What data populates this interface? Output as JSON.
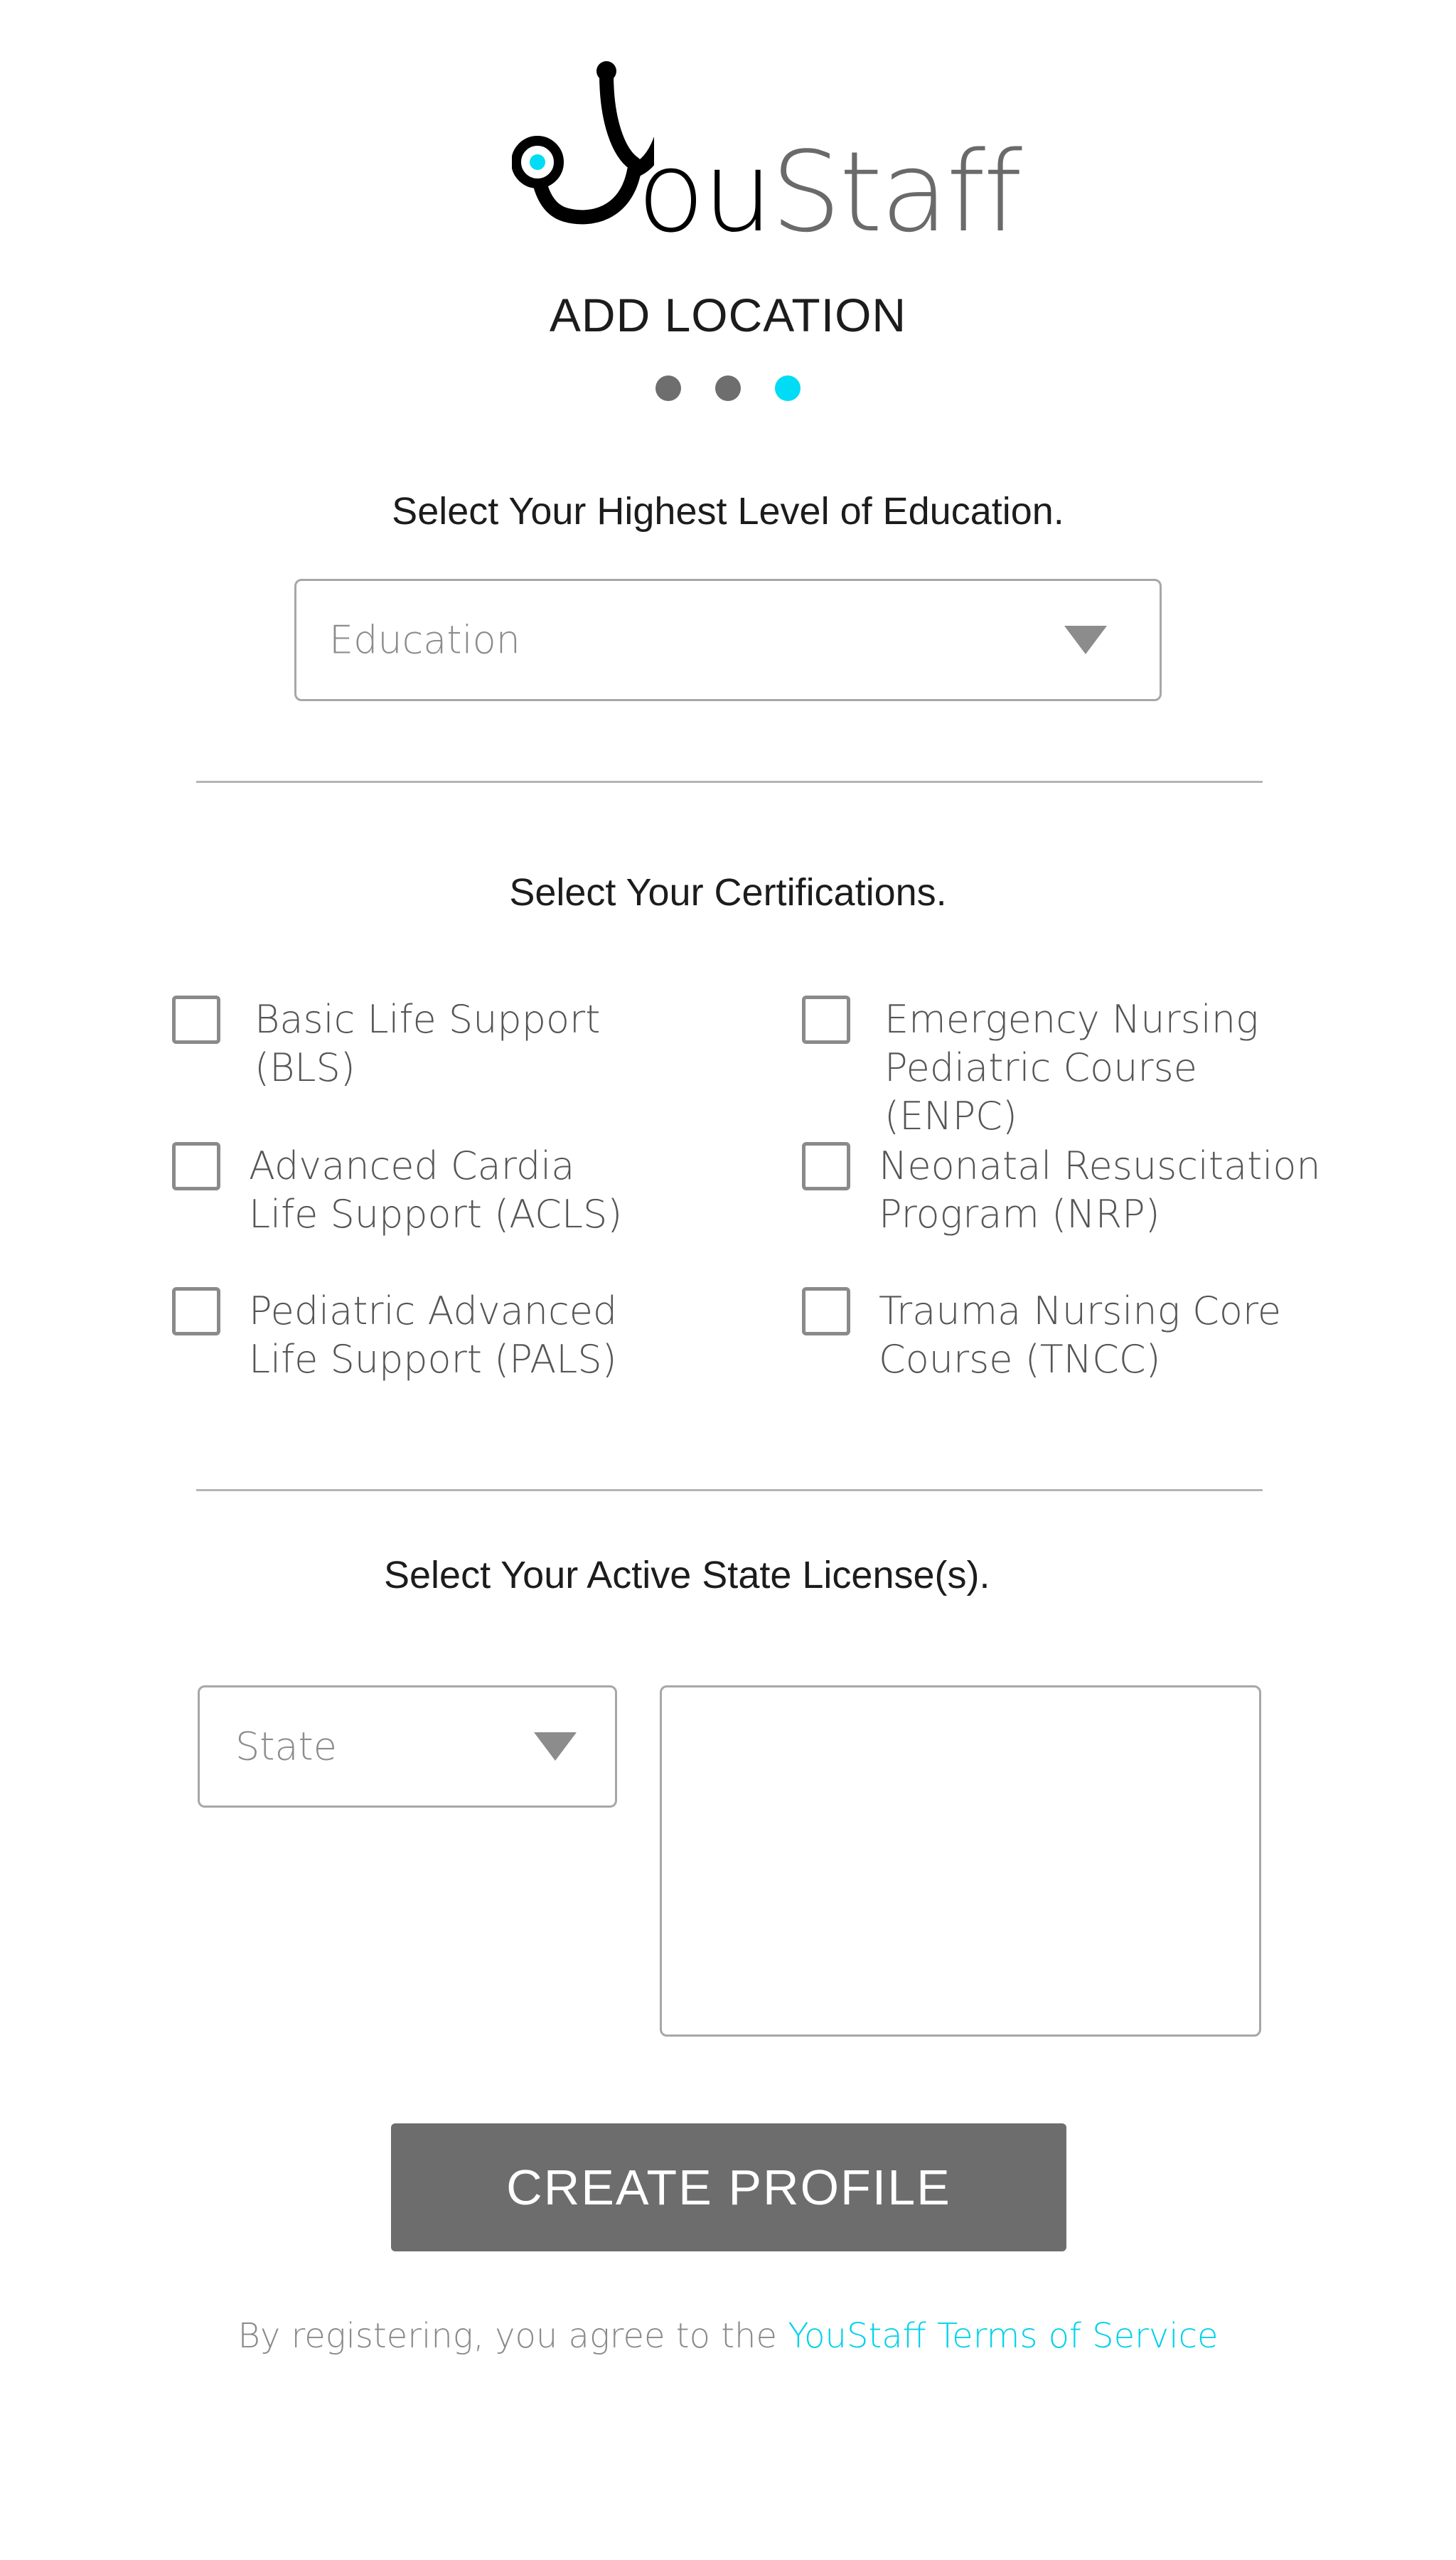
{
  "brand": {
    "logo_text_ou": "ou",
    "logo_text_staff": "Staff",
    "accent_color": "#00dcf5",
    "icon": "stethoscope-y-icon"
  },
  "header": {
    "title": "ADD LOCATION",
    "steps": {
      "total": 3,
      "current": 3
    }
  },
  "education": {
    "prompt": "Select Your Highest Level of Education.",
    "select_value": "Education"
  },
  "certifications": {
    "prompt": "Select Your Certifications.",
    "items": [
      {
        "label": "Basic Life Support (BLS)",
        "checked": false
      },
      {
        "label": "Emergency Nursing Pediatric Course (ENPC)",
        "checked": false
      },
      {
        "label": "Advanced Cardia Life Support (ACLS)",
        "checked": false
      },
      {
        "label": "Neonatal Resuscitation Program (NRP)",
        "checked": false
      },
      {
        "label": "Pediatric Advanced Life Support (PALS)",
        "checked": false
      },
      {
        "label": "Trauma Nursing Core Course (TNCC)",
        "checked": false
      }
    ]
  },
  "licenses": {
    "prompt": "Select Your Active State License(s).",
    "state_select_value": "State"
  },
  "actions": {
    "create_label": "CREATE PROFILE"
  },
  "footer": {
    "prefix": "By registering, you agree to the ",
    "link_text": "YouStaff Terms of Service"
  }
}
